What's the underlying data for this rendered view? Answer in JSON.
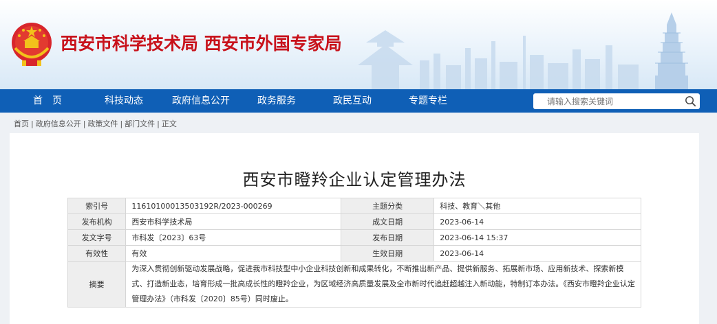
{
  "header": {
    "site_title": "西安市科学技术局  西安市外国专家局"
  },
  "nav": {
    "items": [
      "首　页",
      "科技动态",
      "政府信息公开",
      "政务服务",
      "政民互动",
      "专题专栏"
    ],
    "search_placeholder": "请输入搜索关键词"
  },
  "breadcrumb": [
    "首页",
    "政府信息公开",
    "政策文件",
    "部门文件",
    "正文"
  ],
  "document": {
    "title": "西安市瞪羚企业认定管理办法",
    "meta": {
      "index_label": "索引号",
      "index_value": "11610100013503192R/2023-000269",
      "category_label": "主题分类",
      "category_value": "科技、教育＼其他",
      "issuer_label": "发布机构",
      "issuer_value": "西安市科学技术局",
      "created_label": "成文日期",
      "created_value": "2023-06-14",
      "docno_label": "发文字号",
      "docno_value": "市科发〔2023〕63号",
      "published_label": "发布日期",
      "published_value": "2023-06-14 15:37",
      "validity_label": "有效性",
      "validity_value": "有效",
      "effective_label": "生效日期",
      "effective_value": "2023-06-14",
      "abstract_label": "摘要",
      "abstract_value": "为深入贯彻创新驱动发展战略，促进我市科技型中小企业科技创新和成果转化，不断推出新产品、提供新服务、拓展新市场、应用新技术、探索新模式、打造新业态，培育形成一批高成长性的瞪羚企业，为区域经济高质量发展及全市新时代追赶超越注入新动能，特制订本办法。《西安市瞪羚企业认定管理办法》（市科发〔2020〕85号）同时废止。"
    }
  }
}
